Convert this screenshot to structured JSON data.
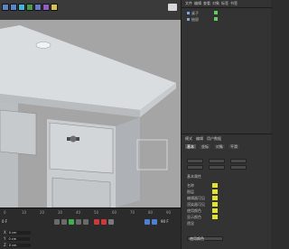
{
  "toolbar": {
    "icons": [
      "undo-icon",
      "redo-icon",
      "select-icon",
      "move-icon",
      "scale-icon",
      "rotate-icon",
      "render-icon"
    ],
    "mode_label": "B"
  },
  "right_panel": {
    "menu": [
      "文件",
      "编辑",
      "查看",
      "对象",
      "标签",
      "书签"
    ],
    "objects": [
      {
        "name": "桌子",
        "icon": "object-icon"
      },
      {
        "name": "抽屉",
        "icon": "object-icon"
      }
    ],
    "attributes_menu": [
      "模式",
      "编辑",
      "用户数据"
    ],
    "attributes_tabs": [
      {
        "label": "基本",
        "active": true
      },
      {
        "label": "坐标",
        "active": false
      },
      {
        "label": "对象",
        "active": false
      },
      {
        "label": "平滑",
        "active": false
      }
    ],
    "properties": [
      {
        "label": "基本属性"
      },
      {
        "label": "名称"
      },
      {
        "label": "图层"
      },
      {
        "label": "编辑器可见"
      },
      {
        "label": "渲染器可见"
      },
      {
        "label": "使用颜色"
      },
      {
        "label": "显示颜色"
      },
      {
        "label": "透显"
      }
    ],
    "swatch_color": "#e3e32e",
    "bottom_button": "使用颜色"
  },
  "timeline": {
    "ticks": [
      "0",
      "10",
      "20",
      "30",
      "40",
      "50",
      "60",
      "70",
      "80",
      "90"
    ],
    "frame_label": "0 F",
    "end_label": "90 F"
  },
  "coordinates": {
    "rows": [
      {
        "axis": "X",
        "value": "0 cm"
      },
      {
        "axis": "Y",
        "value": "0 cm"
      },
      {
        "axis": "Z",
        "value": "0 cm"
      }
    ]
  }
}
